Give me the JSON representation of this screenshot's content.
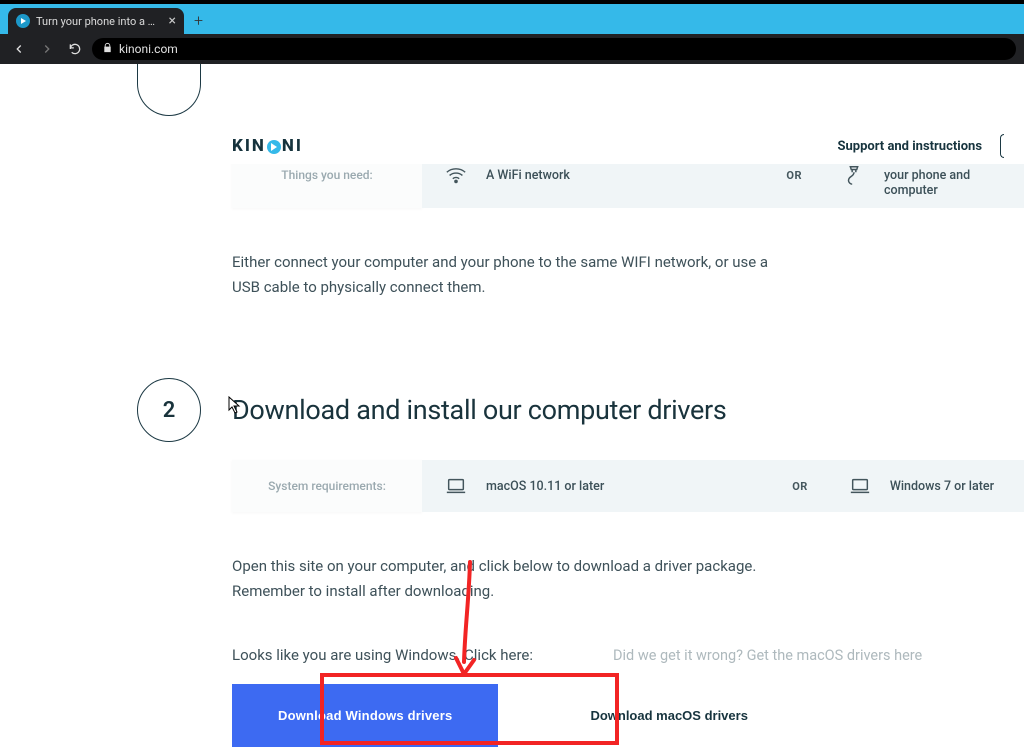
{
  "browser": {
    "tab_title": "Turn your phone into a wireless w",
    "address": "kinoni.com"
  },
  "header": {
    "logo_kin": "KIN",
    "logo_ni": "NI",
    "support_label": "Support and instructions"
  },
  "step1": {
    "requirements_label": "Things you need:",
    "item_a": "A WiFi network",
    "or": "OR",
    "item_b": "USB cable that connects your phone and computer",
    "body": "Either connect your computer and your phone to the same WIFI network, or use a USB cable to physically connect them."
  },
  "step2": {
    "number": "2",
    "heading": "Download and install our computer drivers",
    "requirements_label": "System requirements:",
    "item_a": "macOS 10.11 or later",
    "or": "OR",
    "item_b": "Windows 7 or later",
    "body": "Open this site on your computer, and click below to download a driver package. Remember to install after downloading.",
    "detect_text": "Looks like you are using Windows. Click here:",
    "alt_text": "Did we get it wrong? Get the macOS drivers here",
    "primary_button": "Download Windows drivers",
    "secondary_button": "Download macOS drivers"
  }
}
